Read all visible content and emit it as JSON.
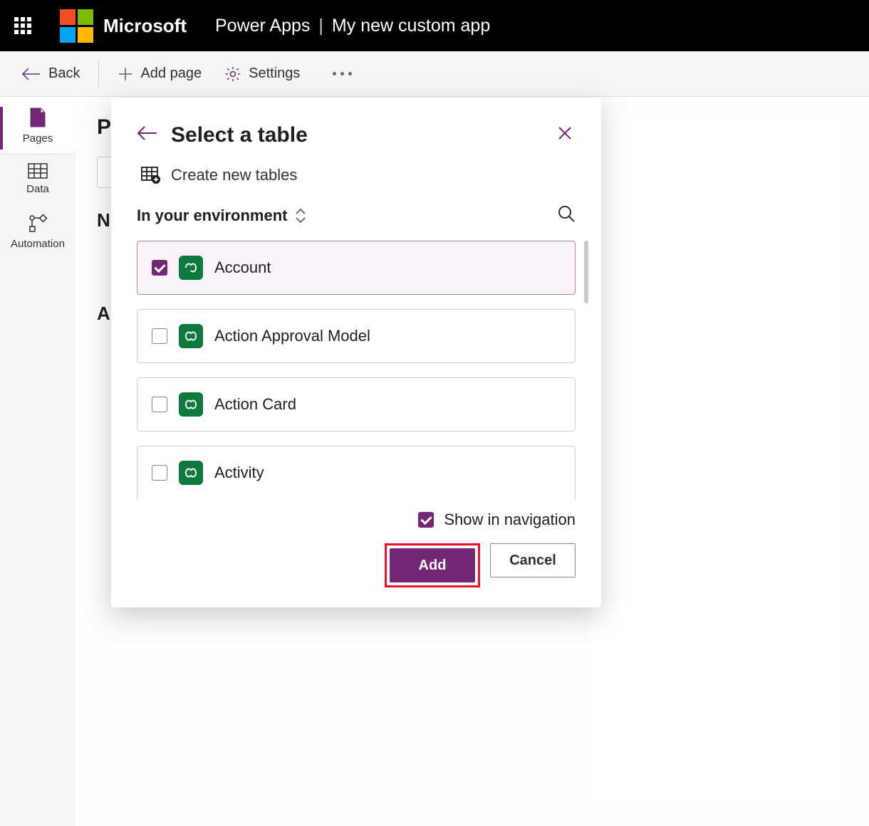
{
  "header": {
    "brand": "Microsoft",
    "product": "Power Apps",
    "app_name": "My new custom app"
  },
  "commands": {
    "back": "Back",
    "add_page": "Add page",
    "settings": "Settings"
  },
  "left_nav": {
    "items": [
      {
        "label": "Pages"
      },
      {
        "label": "Data"
      },
      {
        "label": "Automation"
      }
    ]
  },
  "main": {
    "title_partial": "P",
    "section_nav": "N",
    "section_all": "Al"
  },
  "dialog": {
    "title": "Select a table",
    "create_new": "Create new tables",
    "env_label": "In your environment",
    "tables": [
      {
        "name": "Account",
        "selected": true
      },
      {
        "name": "Action Approval Model",
        "selected": false
      },
      {
        "name": "Action Card",
        "selected": false
      },
      {
        "name": "Activity",
        "selected": false
      }
    ],
    "show_in_nav": "Show in navigation",
    "add": "Add",
    "cancel": "Cancel"
  }
}
